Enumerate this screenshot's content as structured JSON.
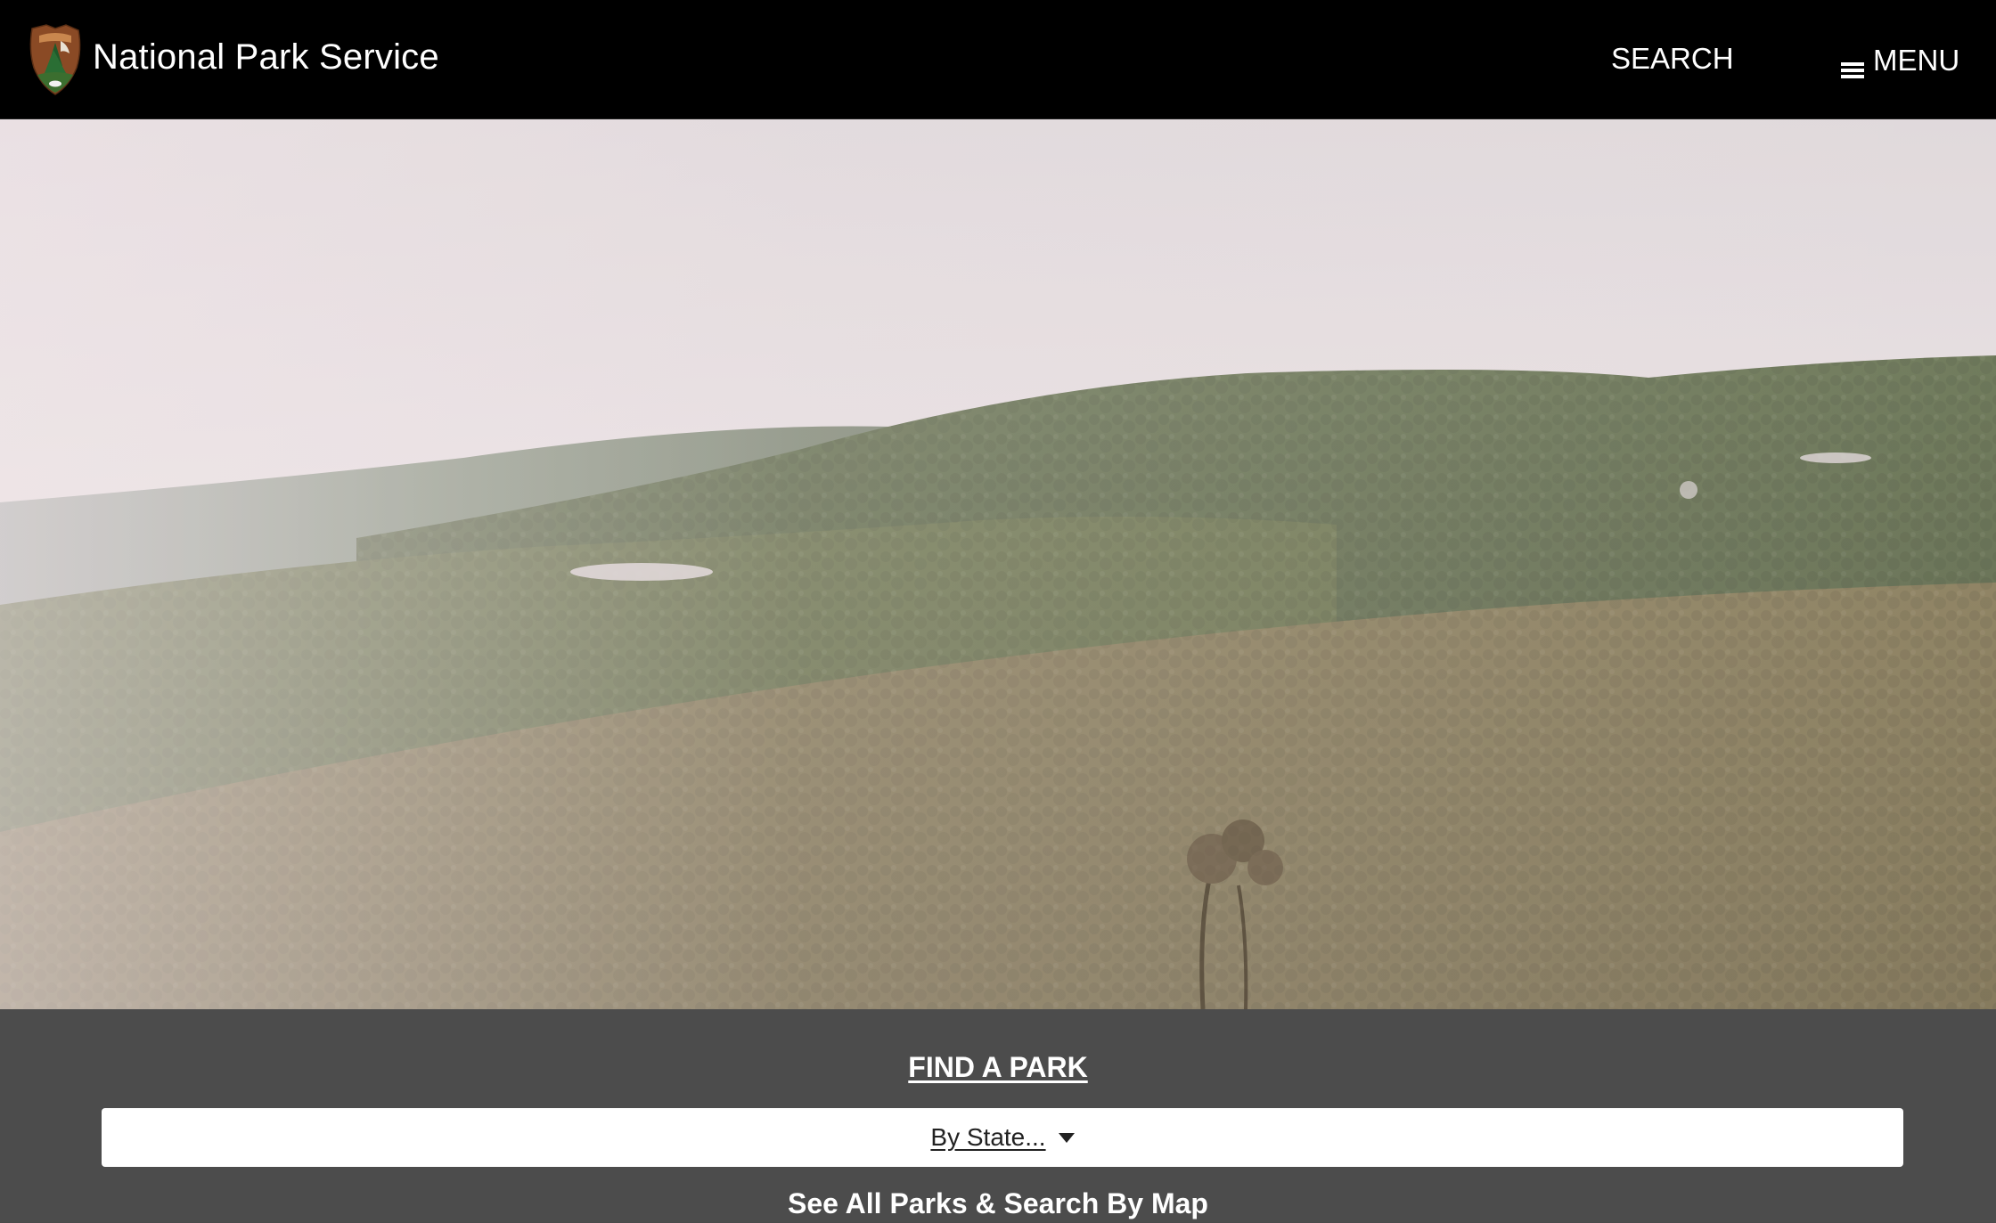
{
  "header": {
    "logo_icon": "nps-arrowhead-icon",
    "site_title": "National Park Service",
    "search_label": "SEARCH",
    "menu_icon": "hamburger-icon",
    "menu_label": "MENU"
  },
  "hero": {
    "image": "forested-mountain-ridges-photo"
  },
  "find_park": {
    "heading": "FIND A PARK",
    "state_select_label": "By State...",
    "state_select_icon": "caret-down-icon",
    "all_parks_link": "See All Parks & Search By Map"
  },
  "colors": {
    "header_bg": "#000000",
    "panel_bg": "#4c4c4c",
    "arrowhead_brown": "#8a4a25",
    "select_bg": "#ffffff"
  }
}
